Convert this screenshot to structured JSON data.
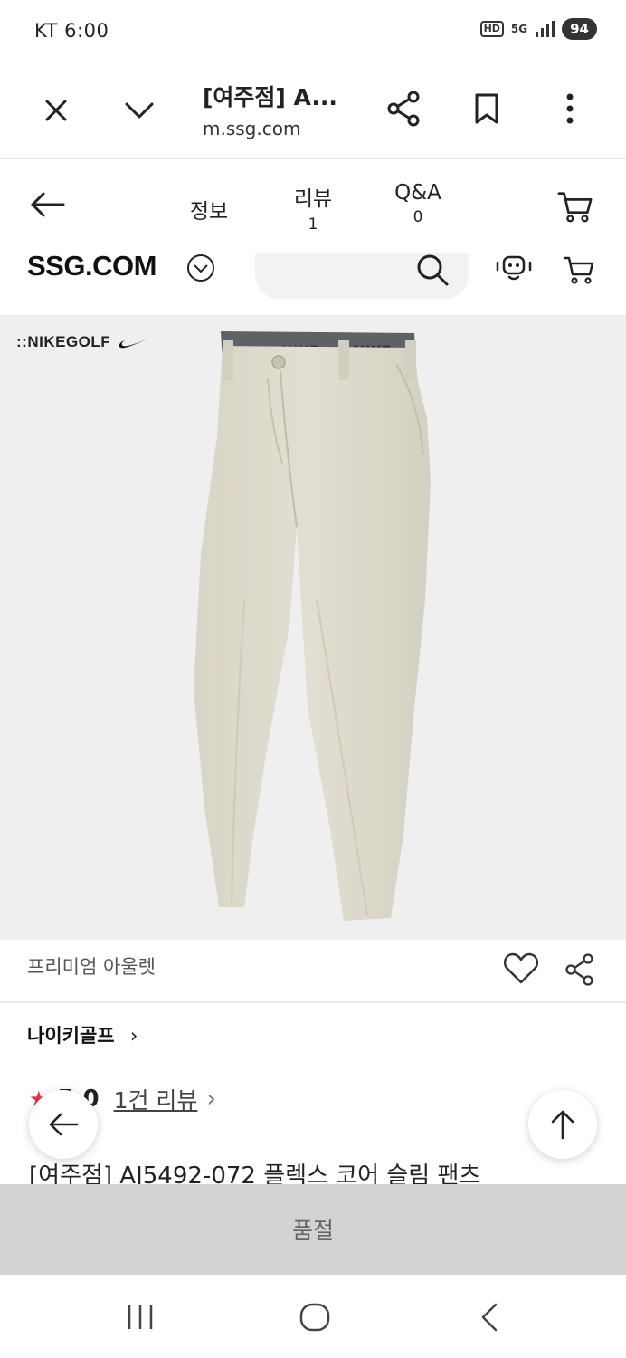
{
  "status_bar": {
    "carrier_time": "KT 6:00",
    "hd": "HD",
    "network": "5G",
    "battery": "94"
  },
  "browser": {
    "page_title": "[여주점] A...",
    "url": "m.ssg.com"
  },
  "tabs": [
    {
      "label": "정보",
      "count": ""
    },
    {
      "label": "리뷰",
      "count": "1"
    },
    {
      "label": "Q&A",
      "count": "0"
    }
  ],
  "ssg": {
    "logo": "SSG.COM"
  },
  "product": {
    "brand_logo": "::NIKEGOLF",
    "waistband_text": "NIKE",
    "shop_label": "프리미엄 아울렛",
    "brand_link": "나이키골프",
    "rating_star": "★",
    "rating": "5.0",
    "review_link": "1건 리뷰",
    "name": "[여주점] AJ5492-072 플렉스 코어 슬림 팬츠",
    "image_color": "#d9d5c8"
  },
  "buy_bar": {
    "label": "품절"
  },
  "icons": [
    "close-icon",
    "chevron-down-icon",
    "share-icon",
    "bookmark-icon",
    "more-icon",
    "back-arrow-icon",
    "cart-icon",
    "search-icon",
    "chatbot-icon",
    "heart-icon",
    "up-arrow-icon",
    "recents-icon",
    "home-icon",
    "back-icon"
  ]
}
